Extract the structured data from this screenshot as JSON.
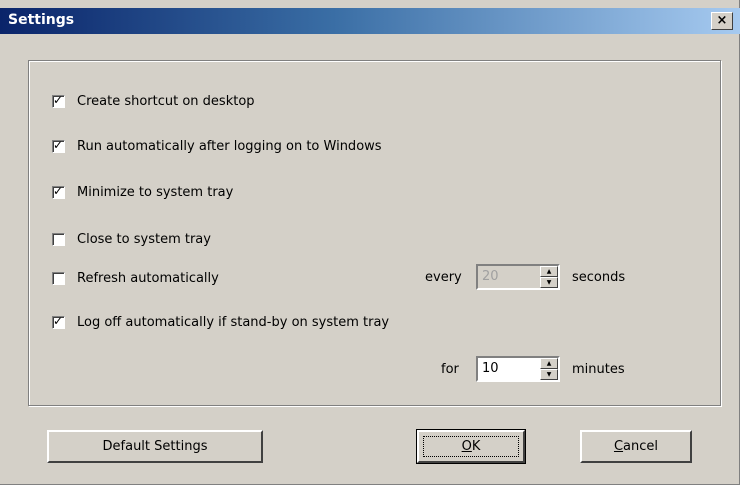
{
  "window": {
    "title": "Settings",
    "close_glyph": "×"
  },
  "options": [
    {
      "label": "Create shortcut on desktop",
      "checked": true
    },
    {
      "label": "Run automatically after logging on to Windows",
      "checked": true
    },
    {
      "label": "Minimize to system tray",
      "checked": true
    },
    {
      "label": "Close to system tray",
      "checked": false
    },
    {
      "label": "Refresh automatically",
      "checked": false
    },
    {
      "label": "Log off automatically if stand-by on system tray",
      "checked": true
    }
  ],
  "refresh_interval": {
    "prefix": "every",
    "value": "20",
    "unit": "seconds",
    "enabled": false
  },
  "logoff_interval": {
    "prefix": "for",
    "value": "10",
    "unit": "minutes",
    "enabled": true
  },
  "buttons": {
    "default_settings": "Default Settings",
    "ok": {
      "mnemonic": "O",
      "rest": "K"
    },
    "cancel": {
      "mnemonic": "C",
      "rest": "ancel"
    }
  },
  "check_glyph": "✓"
}
